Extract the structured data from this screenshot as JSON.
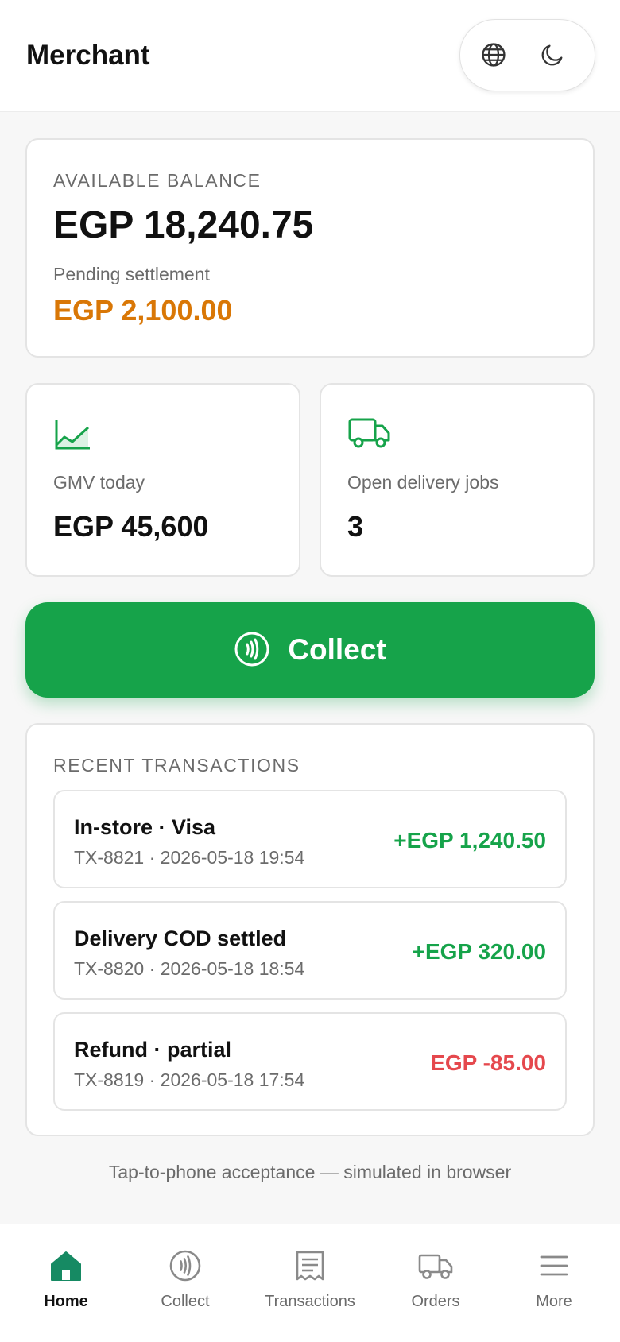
{
  "header": {
    "title": "Merchant",
    "language_icon": "globe-icon",
    "theme_icon": "moon-icon"
  },
  "balance": {
    "label": "AVAILABLE BALANCE",
    "value": "EGP 18,240.75",
    "pending_label": "Pending settlement",
    "pending_value": "EGP 2,100.00"
  },
  "stats": [
    {
      "icon": "chart-line-icon",
      "label": "GMV today",
      "value": "EGP 45,600"
    },
    {
      "icon": "truck-icon",
      "label": "Open delivery jobs",
      "value": "3"
    }
  ],
  "collect": {
    "label": "Collect",
    "icon": "contactless-icon"
  },
  "transactions": {
    "label": "RECENT TRANSACTIONS",
    "items": [
      {
        "title": "In-store · Visa",
        "meta": "TX-8821 · 2026-05-18 19:54",
        "amount": "+EGP 1,240.50",
        "sign": "positive"
      },
      {
        "title": "Delivery COD settled",
        "meta": "TX-8820 · 2026-05-18 18:54",
        "amount": "+EGP 320.00",
        "sign": "positive"
      },
      {
        "title": "Refund · partial",
        "meta": "TX-8819 · 2026-05-18 17:54",
        "amount": "EGP -85.00",
        "sign": "negative"
      }
    ]
  },
  "footnote": "Tap-to-phone acceptance — simulated in browser",
  "nav": {
    "items": [
      {
        "label": "Home",
        "icon": "home-icon",
        "active": true
      },
      {
        "label": "Collect",
        "icon": "contactless-icon",
        "active": false
      },
      {
        "label": "Transactions",
        "icon": "receipt-icon",
        "active": false
      },
      {
        "label": "Orders",
        "icon": "truck-icon",
        "active": false
      },
      {
        "label": "More",
        "icon": "menu-icon",
        "active": false
      }
    ]
  },
  "colors": {
    "brand_green": "#16a34a",
    "pending_orange": "#d97706",
    "negative_red": "#e5484d",
    "active_nav": "#168a63"
  }
}
